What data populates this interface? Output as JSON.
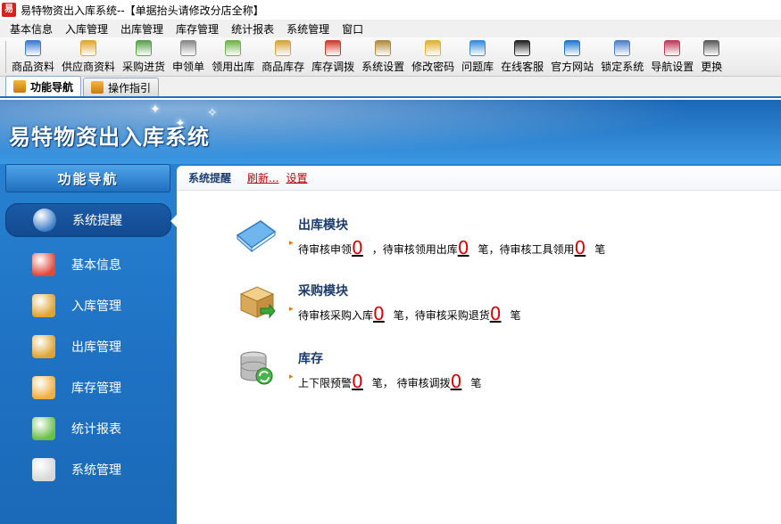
{
  "window": {
    "app_icon_glyph": "易",
    "title": "易特物资出入库系统--【单据抬头请修改分店全称】"
  },
  "menu": [
    "基本信息",
    "入库管理",
    "出库管理",
    "库存管理",
    "统计报表",
    "系统管理",
    "窗口"
  ],
  "toolbar": [
    {
      "label": "商品资料",
      "icon": "product-icon",
      "color": "#3a7ad0"
    },
    {
      "label": "供应商资料",
      "icon": "supplier-icon",
      "color": "#e0a431"
    },
    {
      "label": "采购进货",
      "icon": "purchase-icon",
      "color": "#5aa04a"
    },
    {
      "label": "申领单",
      "icon": "requisition-icon",
      "color": "#888888"
    },
    {
      "label": "领用出库",
      "icon": "cart-icon",
      "color": "#6bb34a"
    },
    {
      "label": "商品库存",
      "icon": "stock-icon",
      "color": "#d8a23a"
    },
    {
      "label": "库存调拨",
      "icon": "transfer-icon",
      "color": "#d23a2a"
    },
    {
      "label": "系统设置",
      "icon": "settings-icon",
      "color": "#b08a3a"
    },
    {
      "label": "修改密码",
      "icon": "password-icon",
      "color": "#e0b030"
    },
    {
      "label": "问题库",
      "icon": "question-icon",
      "color": "#3a8ad8"
    },
    {
      "label": "在线客服",
      "icon": "qq-icon",
      "color": "#222222"
    },
    {
      "label": "官方网站",
      "icon": "ie-icon",
      "color": "#1f78d0"
    },
    {
      "label": "锁定系统",
      "icon": "lock-icon",
      "color": "#4a80c8"
    },
    {
      "label": "导航设置",
      "icon": "nav-settings-icon",
      "color": "#c03a5a"
    },
    {
      "label": "更换",
      "icon": "switch-icon",
      "color": "#5a5a5a"
    }
  ],
  "tabs": [
    {
      "label": "功能导航",
      "active": true
    },
    {
      "label": "操作指引",
      "active": false
    }
  ],
  "banner": {
    "title": "易特物资出入库系统"
  },
  "sidebar": {
    "header": "功能导航",
    "items": [
      {
        "label": "系统提醒",
        "icon": "info-icon",
        "color": "#3f7fc8",
        "active": true
      },
      {
        "label": "基本信息",
        "icon": "cubes-icon",
        "color": "#e04a3a",
        "active": false
      },
      {
        "label": "入库管理",
        "icon": "box-in-icon",
        "color": "#e0a431",
        "active": false
      },
      {
        "label": "出库管理",
        "icon": "box-out-icon",
        "color": "#e0a431",
        "active": false
      },
      {
        "label": "库存管理",
        "icon": "house-icon",
        "color": "#f0b040",
        "active": false
      },
      {
        "label": "统计报表",
        "icon": "bar-chart-icon",
        "color": "#6cc04a",
        "active": false
      },
      {
        "label": "系统管理",
        "icon": "tools-icon",
        "color": "#d8d8d8",
        "active": false
      }
    ]
  },
  "panel": {
    "title": "系统提醒",
    "refresh": "刷新...",
    "settings": "设置"
  },
  "modules": [
    {
      "title": "出库模块",
      "icon": "book-icon",
      "parts": [
        {
          "text": "待审核申领",
          "num": "0"
        },
        {
          "text": "，待审核领用出库",
          "num": "0"
        },
        {
          "text": "笔，待审核工具领用",
          "num": "0"
        },
        {
          "text": "笔",
          "num": null
        }
      ]
    },
    {
      "title": "采购模块",
      "icon": "package-icon",
      "parts": [
        {
          "text": "待审核采购入库",
          "num": "0"
        },
        {
          "text": "笔，待审核采购退货",
          "num": "0"
        },
        {
          "text": "笔",
          "num": null
        }
      ]
    },
    {
      "title": "库存",
      "icon": "database-icon",
      "parts": [
        {
          "text": "上下限预警",
          "num": "0"
        },
        {
          "text": "笔， 待审核调拨",
          "num": "0"
        },
        {
          "text": "笔",
          "num": null
        }
      ]
    }
  ]
}
